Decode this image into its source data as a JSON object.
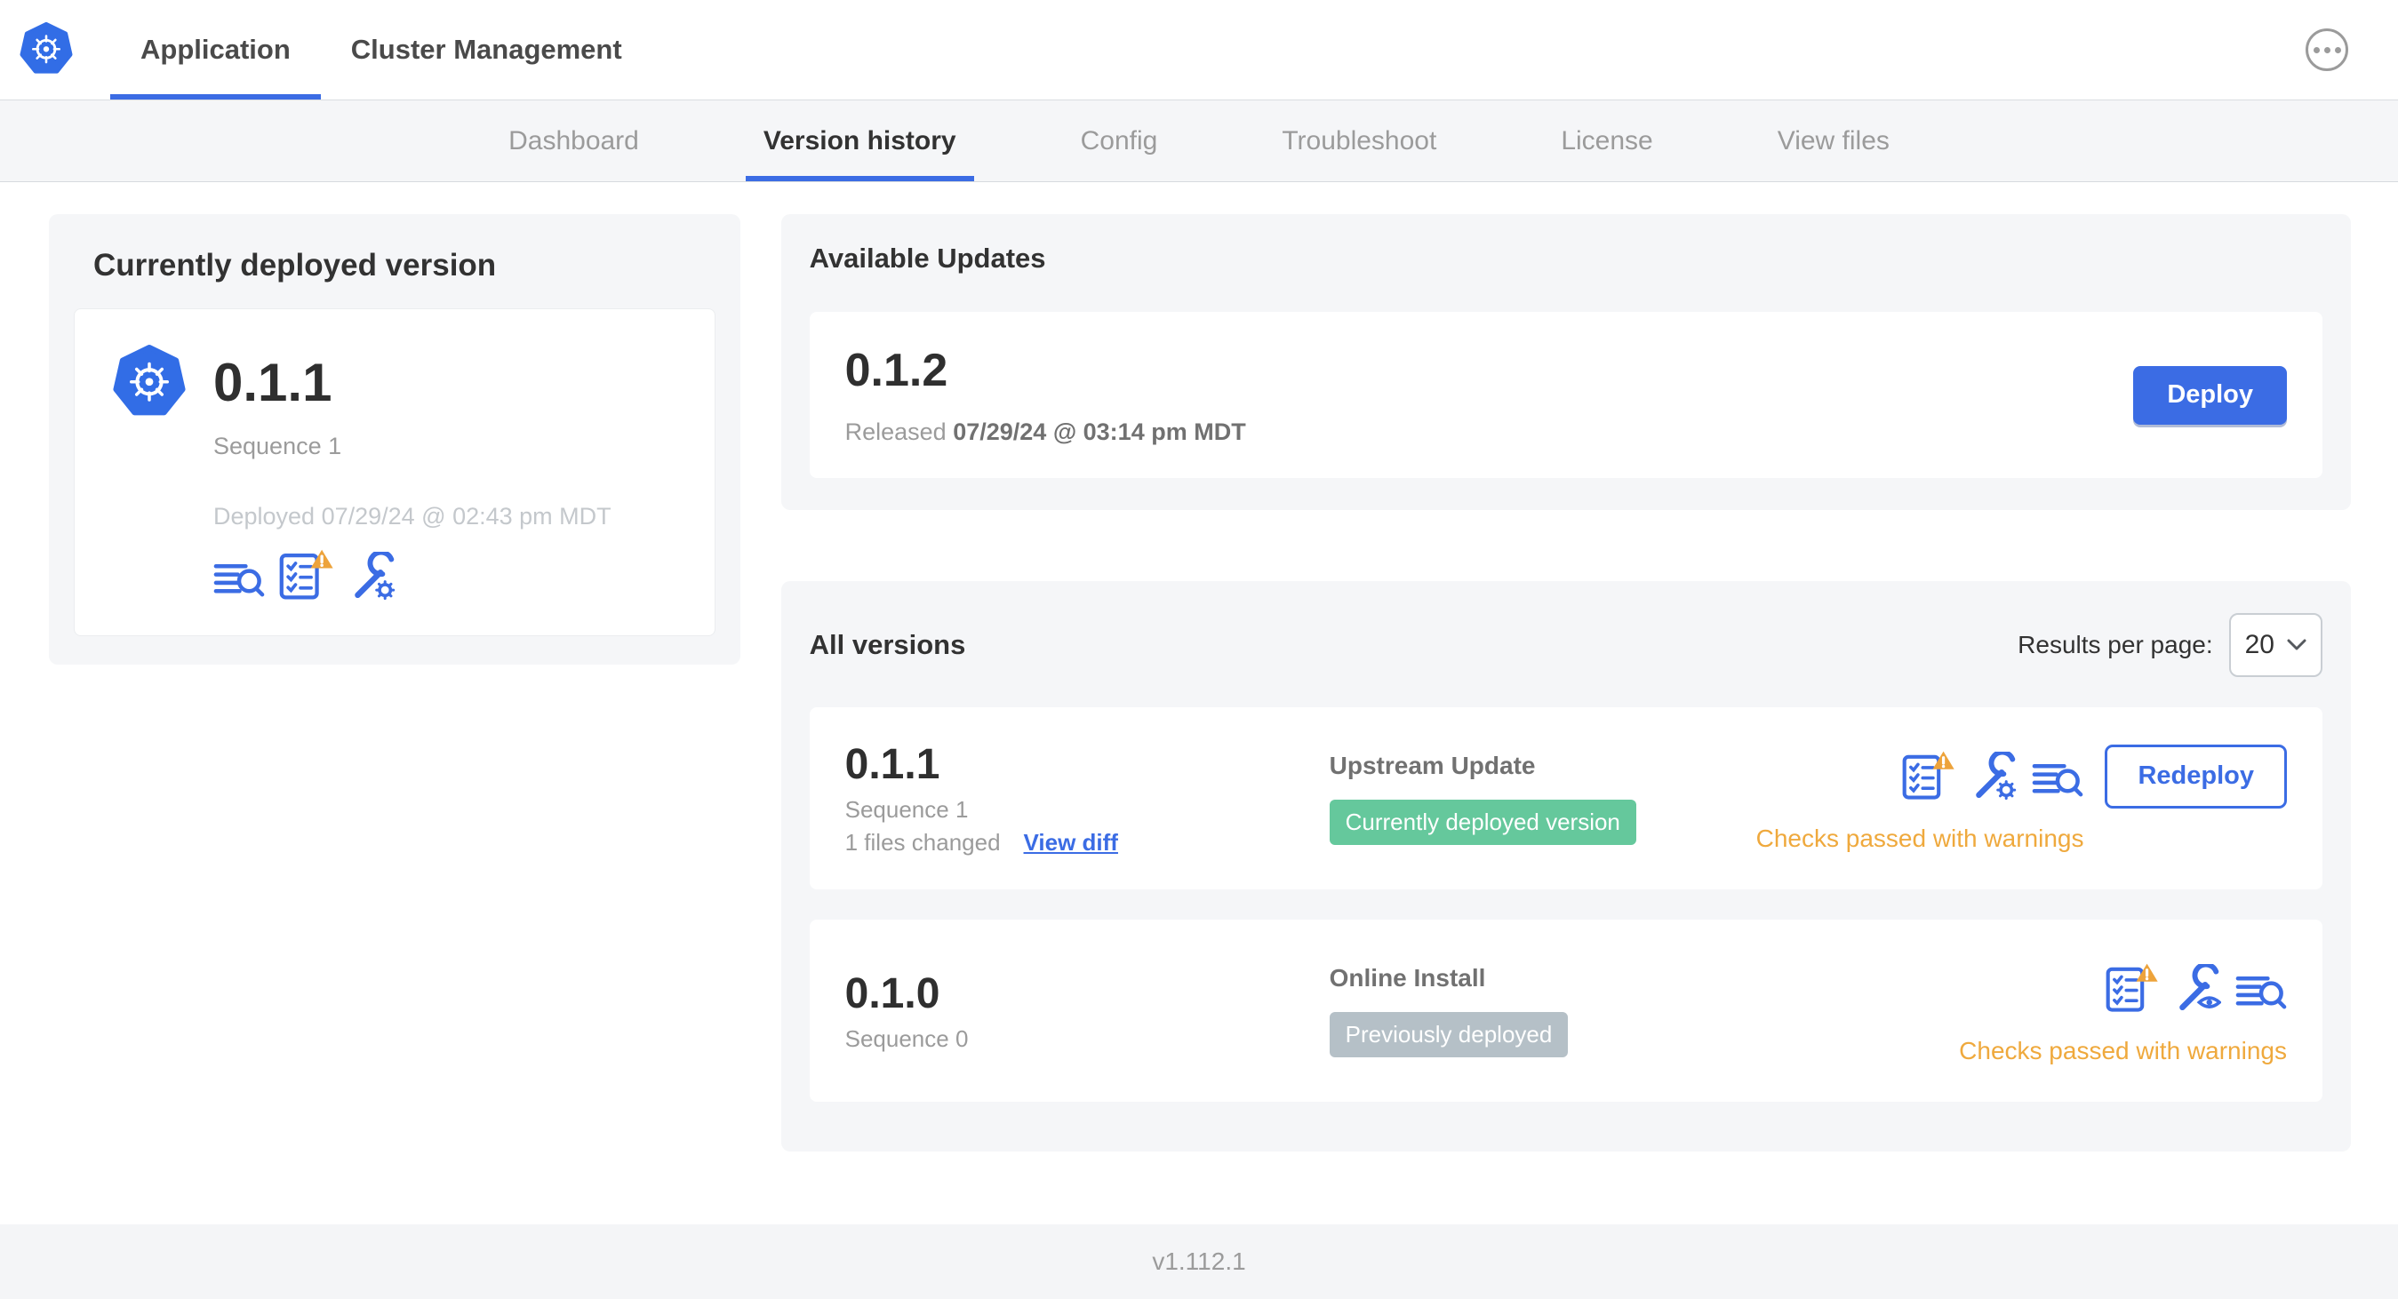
{
  "colors": {
    "accent_blue": "#3b6ce4",
    "logo_blue": "#326de6",
    "warning_amber": "#efa93d",
    "badge_green": "#65c89c",
    "badge_gray": "#b5c0c7",
    "panel_gray": "#f5f6f8"
  },
  "header": {
    "logo_icon": "kubernetes-logo",
    "tabs": [
      {
        "label": "Application",
        "active": true
      },
      {
        "label": "Cluster Management",
        "active": false
      }
    ],
    "more_icon": "ellipsis-menu-icon"
  },
  "subnav": {
    "items": [
      {
        "label": "Dashboard",
        "active": false
      },
      {
        "label": "Version history",
        "active": true
      },
      {
        "label": "Config",
        "active": false
      },
      {
        "label": "Troubleshoot",
        "active": false
      },
      {
        "label": "License",
        "active": false
      },
      {
        "label": "View files",
        "active": false
      }
    ]
  },
  "current_version": {
    "title": "Currently deployed version",
    "version": "0.1.1",
    "sequence": "Sequence 1",
    "deployed": "Deployed 07/29/24 @ 02:43 pm MDT",
    "icons": [
      "diff-icon",
      "preflight-checks-warning-icon",
      "config-wrench-gear-icon"
    ]
  },
  "available_updates": {
    "title": "Available Updates",
    "update": {
      "version": "0.1.2",
      "released_label": "Released",
      "released_date": "07/29/24 @ 03:14 pm MDT",
      "deploy_label": "Deploy"
    }
  },
  "all_versions": {
    "title": "All versions",
    "results_per_page": {
      "label": "Results per page:",
      "value": "20"
    },
    "rows": [
      {
        "version": "0.1.1",
        "sequence": "Sequence 1",
        "files_changed": "1 files changed",
        "view_diff": "View diff",
        "source": "Upstream Update",
        "status_badge": "Currently deployed version",
        "badge_color": "#65c89c",
        "icons": [
          "preflight-checks-warning-icon",
          "config-wrench-gear-icon",
          "diff-icon"
        ],
        "checks": "Checks passed with warnings",
        "action": "Redeploy"
      },
      {
        "version": "0.1.0",
        "sequence": "Sequence 0",
        "source": "Online Install",
        "status_badge": "Previously deployed",
        "badge_color": "#b5c0c7",
        "icons": [
          "preflight-checks-warning-icon",
          "config-wrench-eye-icon",
          "diff-icon"
        ],
        "checks": "Checks passed with warnings"
      }
    ]
  },
  "footer": {
    "app_version": "v1.112.1"
  }
}
